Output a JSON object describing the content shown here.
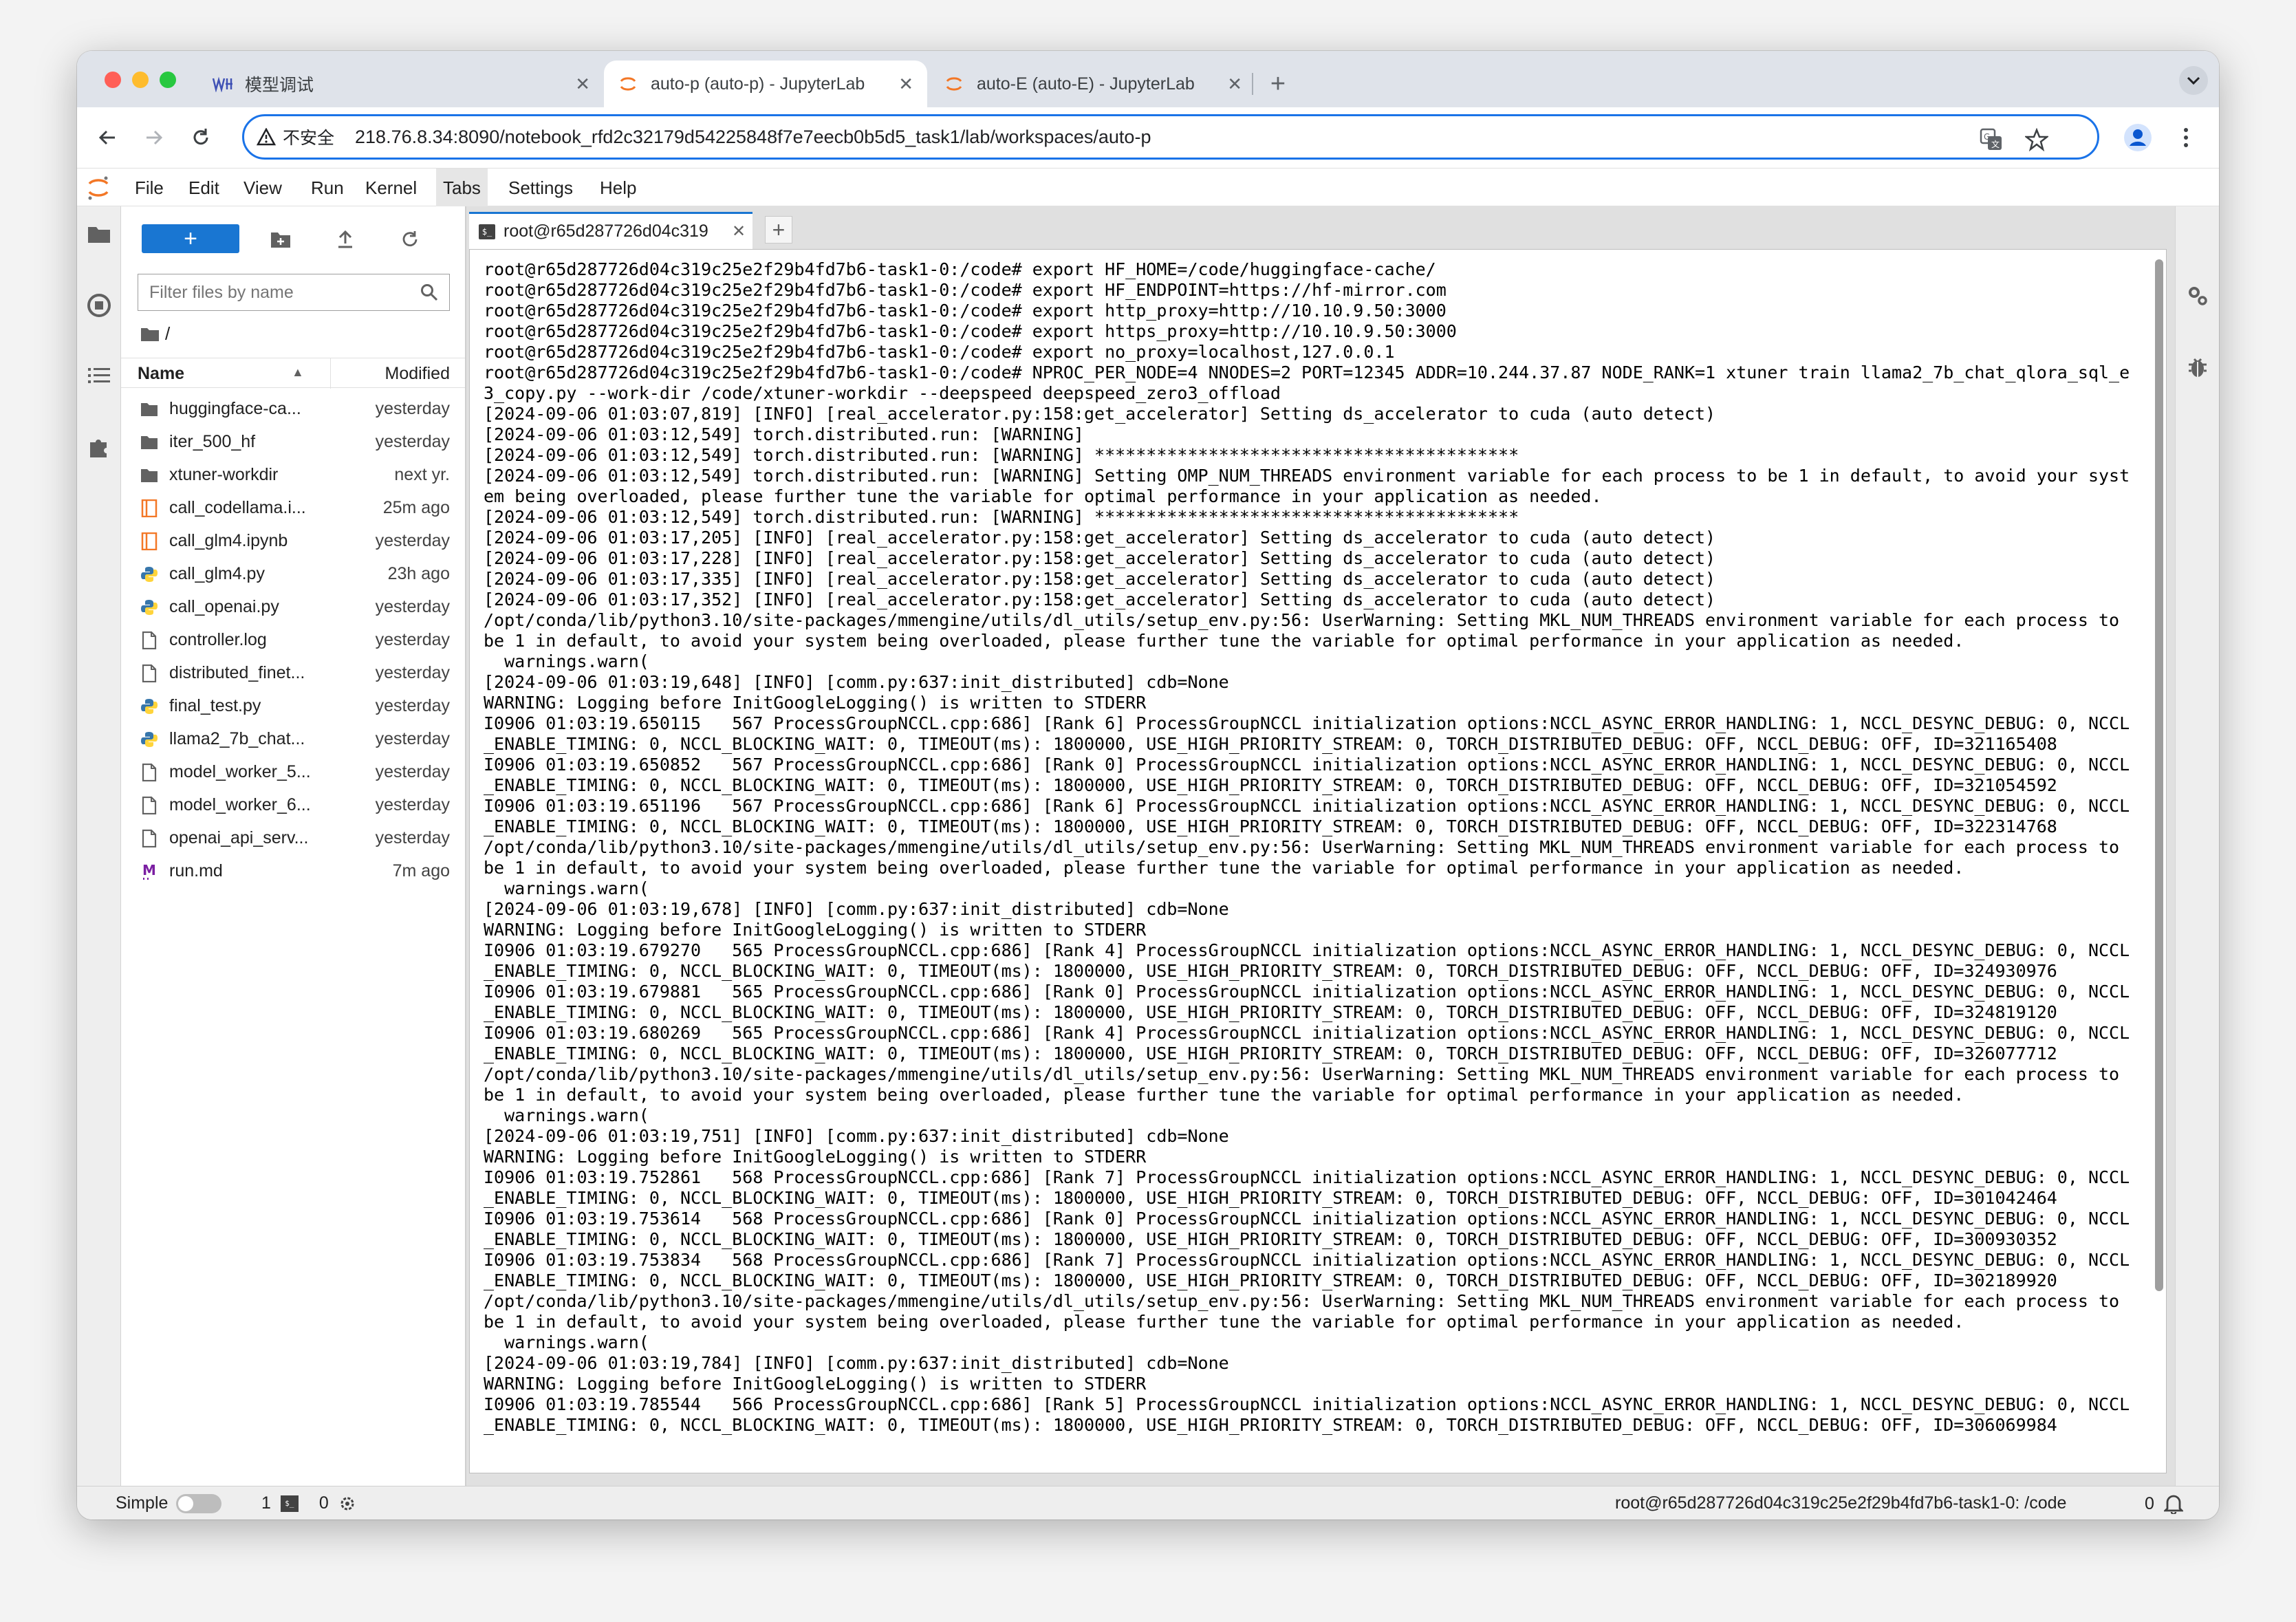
{
  "browser": {
    "tabs": [
      {
        "title": "模型调试",
        "active": false
      },
      {
        "title": "auto-p (auto-p) - JupyterLab",
        "active": true
      },
      {
        "title": "auto-E (auto-E) - JupyterLab",
        "active": false
      }
    ],
    "security_label": "不安全",
    "url": "218.76.8.34:8090/notebook_rfd2c32179d54225848f7e7eecb0b5d5_task1/lab/workspaces/auto-p"
  },
  "menubar": {
    "items": [
      "File",
      "Edit",
      "View",
      "Run",
      "Kernel",
      "Tabs",
      "Settings",
      "Help"
    ],
    "highlighted": "Tabs"
  },
  "filebrowser": {
    "new_button_label": "+",
    "filter_placeholder": "Filter files by name",
    "breadcrumb": "/",
    "columns": {
      "name": "Name",
      "modified": "Modified"
    },
    "files": [
      {
        "name": "huggingface-ca...",
        "modified": "yesterday",
        "icon": "folder-icon"
      },
      {
        "name": "iter_500_hf",
        "modified": "yesterday",
        "icon": "folder-icon"
      },
      {
        "name": "xtuner-workdir",
        "modified": "next yr.",
        "icon": "folder-icon"
      },
      {
        "name": "call_codellama.i...",
        "modified": "25m ago",
        "icon": "notebook-icon"
      },
      {
        "name": "call_glm4.ipynb",
        "modified": "yesterday",
        "icon": "notebook-icon"
      },
      {
        "name": "call_glm4.py",
        "modified": "23h ago",
        "icon": "python-icon"
      },
      {
        "name": "call_openai.py",
        "modified": "yesterday",
        "icon": "python-icon"
      },
      {
        "name": "controller.log",
        "modified": "yesterday",
        "icon": "file-icon"
      },
      {
        "name": "distributed_finet...",
        "modified": "yesterday",
        "icon": "file-icon"
      },
      {
        "name": "final_test.py",
        "modified": "yesterday",
        "icon": "python-icon"
      },
      {
        "name": "llama2_7b_chat...",
        "modified": "yesterday",
        "icon": "python-icon"
      },
      {
        "name": "model_worker_5...",
        "modified": "yesterday",
        "icon": "file-icon"
      },
      {
        "name": "model_worker_6...",
        "modified": "yesterday",
        "icon": "file-icon"
      },
      {
        "name": "openai_api_serv...",
        "modified": "yesterday",
        "icon": "file-icon"
      },
      {
        "name": "run.md",
        "modified": "7m ago",
        "icon": "markdown-icon"
      }
    ]
  },
  "terminal": {
    "tab_title": "root@r65d287726d04c319",
    "lines": [
      "root@r65d287726d04c319c25e2f29b4fd7b6-task1-0:/code# export HF_HOME=/code/huggingface-cache/",
      "root@r65d287726d04c319c25e2f29b4fd7b6-task1-0:/code# export HF_ENDPOINT=https://hf-mirror.com",
      "root@r65d287726d04c319c25e2f29b4fd7b6-task1-0:/code# export http_proxy=http://10.10.9.50:3000",
      "root@r65d287726d04c319c25e2f29b4fd7b6-task1-0:/code# export https_proxy=http://10.10.9.50:3000",
      "root@r65d287726d04c319c25e2f29b4fd7b6-task1-0:/code# export no_proxy=localhost,127.0.0.1",
      "root@r65d287726d04c319c25e2f29b4fd7b6-task1-0:/code# NPROC_PER_NODE=4 NNODES=2 PORT=12345 ADDR=10.244.37.87 NODE_RANK=1 xtuner train llama2_7b_chat_qlora_sql_e",
      "3_copy.py --work-dir /code/xtuner-workdir --deepspeed deepspeed_zero3_offload",
      "[2024-09-06 01:03:07,819] [INFO] [real_accelerator.py:158:get_accelerator] Setting ds_accelerator to cuda (auto detect)",
      "[2024-09-06 01:03:12,549] torch.distributed.run: [WARNING]",
      "[2024-09-06 01:03:12,549] torch.distributed.run: [WARNING] *****************************************",
      "[2024-09-06 01:03:12,549] torch.distributed.run: [WARNING] Setting OMP_NUM_THREADS environment variable for each process to be 1 in default, to avoid your syst",
      "em being overloaded, please further tune the variable for optimal performance in your application as needed.",
      "[2024-09-06 01:03:12,549] torch.distributed.run: [WARNING] *****************************************",
      "[2024-09-06 01:03:17,205] [INFO] [real_accelerator.py:158:get_accelerator] Setting ds_accelerator to cuda (auto detect)",
      "[2024-09-06 01:03:17,228] [INFO] [real_accelerator.py:158:get_accelerator] Setting ds_accelerator to cuda (auto detect)",
      "[2024-09-06 01:03:17,335] [INFO] [real_accelerator.py:158:get_accelerator] Setting ds_accelerator to cuda (auto detect)",
      "[2024-09-06 01:03:17,352] [INFO] [real_accelerator.py:158:get_accelerator] Setting ds_accelerator to cuda (auto detect)",
      "/opt/conda/lib/python3.10/site-packages/mmengine/utils/dl_utils/setup_env.py:56: UserWarning: Setting MKL_NUM_THREADS environment variable for each process to",
      "be 1 in default, to avoid your system being overloaded, please further tune the variable for optimal performance in your application as needed.",
      "  warnings.warn(",
      "[2024-09-06 01:03:19,648] [INFO] [comm.py:637:init_distributed] cdb=None",
      "WARNING: Logging before InitGoogleLogging() is written to STDERR",
      "I0906 01:03:19.650115   567 ProcessGroupNCCL.cpp:686] [Rank 6] ProcessGroupNCCL initialization options:NCCL_ASYNC_ERROR_HANDLING: 1, NCCL_DESYNC_DEBUG: 0, NCCL",
      "_ENABLE_TIMING: 0, NCCL_BLOCKING_WAIT: 0, TIMEOUT(ms): 1800000, USE_HIGH_PRIORITY_STREAM: 0, TORCH_DISTRIBUTED_DEBUG: OFF, NCCL_DEBUG: OFF, ID=321165408",
      "I0906 01:03:19.650852   567 ProcessGroupNCCL.cpp:686] [Rank 0] ProcessGroupNCCL initialization options:NCCL_ASYNC_ERROR_HANDLING: 1, NCCL_DESYNC_DEBUG: 0, NCCL",
      "_ENABLE_TIMING: 0, NCCL_BLOCKING_WAIT: 0, TIMEOUT(ms): 1800000, USE_HIGH_PRIORITY_STREAM: 0, TORCH_DISTRIBUTED_DEBUG: OFF, NCCL_DEBUG: OFF, ID=321054592",
      "I0906 01:03:19.651196   567 ProcessGroupNCCL.cpp:686] [Rank 6] ProcessGroupNCCL initialization options:NCCL_ASYNC_ERROR_HANDLING: 1, NCCL_DESYNC_DEBUG: 0, NCCL",
      "_ENABLE_TIMING: 0, NCCL_BLOCKING_WAIT: 0, TIMEOUT(ms): 1800000, USE_HIGH_PRIORITY_STREAM: 0, TORCH_DISTRIBUTED_DEBUG: OFF, NCCL_DEBUG: OFF, ID=322314768",
      "/opt/conda/lib/python3.10/site-packages/mmengine/utils/dl_utils/setup_env.py:56: UserWarning: Setting MKL_NUM_THREADS environment variable for each process to",
      "be 1 in default, to avoid your system being overloaded, please further tune the variable for optimal performance in your application as needed.",
      "  warnings.warn(",
      "[2024-09-06 01:03:19,678] [INFO] [comm.py:637:init_distributed] cdb=None",
      "WARNING: Logging before InitGoogleLogging() is written to STDERR",
      "I0906 01:03:19.679270   565 ProcessGroupNCCL.cpp:686] [Rank 4] ProcessGroupNCCL initialization options:NCCL_ASYNC_ERROR_HANDLING: 1, NCCL_DESYNC_DEBUG: 0, NCCL",
      "_ENABLE_TIMING: 0, NCCL_BLOCKING_WAIT: 0, TIMEOUT(ms): 1800000, USE_HIGH_PRIORITY_STREAM: 0, TORCH_DISTRIBUTED_DEBUG: OFF, NCCL_DEBUG: OFF, ID=324930976",
      "I0906 01:03:19.679881   565 ProcessGroupNCCL.cpp:686] [Rank 0] ProcessGroupNCCL initialization options:NCCL_ASYNC_ERROR_HANDLING: 1, NCCL_DESYNC_DEBUG: 0, NCCL",
      "_ENABLE_TIMING: 0, NCCL_BLOCKING_WAIT: 0, TIMEOUT(ms): 1800000, USE_HIGH_PRIORITY_STREAM: 0, TORCH_DISTRIBUTED_DEBUG: OFF, NCCL_DEBUG: OFF, ID=324819120",
      "I0906 01:03:19.680269   565 ProcessGroupNCCL.cpp:686] [Rank 4] ProcessGroupNCCL initialization options:NCCL_ASYNC_ERROR_HANDLING: 1, NCCL_DESYNC_DEBUG: 0, NCCL",
      "_ENABLE_TIMING: 0, NCCL_BLOCKING_WAIT: 0, TIMEOUT(ms): 1800000, USE_HIGH_PRIORITY_STREAM: 0, TORCH_DISTRIBUTED_DEBUG: OFF, NCCL_DEBUG: OFF, ID=326077712",
      "/opt/conda/lib/python3.10/site-packages/mmengine/utils/dl_utils/setup_env.py:56: UserWarning: Setting MKL_NUM_THREADS environment variable for each process to",
      "be 1 in default, to avoid your system being overloaded, please further tune the variable for optimal performance in your application as needed.",
      "  warnings.warn(",
      "[2024-09-06 01:03:19,751] [INFO] [comm.py:637:init_distributed] cdb=None",
      "WARNING: Logging before InitGoogleLogging() is written to STDERR",
      "I0906 01:03:19.752861   568 ProcessGroupNCCL.cpp:686] [Rank 7] ProcessGroupNCCL initialization options:NCCL_ASYNC_ERROR_HANDLING: 1, NCCL_DESYNC_DEBUG: 0, NCCL",
      "_ENABLE_TIMING: 0, NCCL_BLOCKING_WAIT: 0, TIMEOUT(ms): 1800000, USE_HIGH_PRIORITY_STREAM: 0, TORCH_DISTRIBUTED_DEBUG: OFF, NCCL_DEBUG: OFF, ID=301042464",
      "I0906 01:03:19.753614   568 ProcessGroupNCCL.cpp:686] [Rank 0] ProcessGroupNCCL initialization options:NCCL_ASYNC_ERROR_HANDLING: 1, NCCL_DESYNC_DEBUG: 0, NCCL",
      "_ENABLE_TIMING: 0, NCCL_BLOCKING_WAIT: 0, TIMEOUT(ms): 1800000, USE_HIGH_PRIORITY_STREAM: 0, TORCH_DISTRIBUTED_DEBUG: OFF, NCCL_DEBUG: OFF, ID=300930352",
      "I0906 01:03:19.753834   568 ProcessGroupNCCL.cpp:686] [Rank 7] ProcessGroupNCCL initialization options:NCCL_ASYNC_ERROR_HANDLING: 1, NCCL_DESYNC_DEBUG: 0, NCCL",
      "_ENABLE_TIMING: 0, NCCL_BLOCKING_WAIT: 0, TIMEOUT(ms): 1800000, USE_HIGH_PRIORITY_STREAM: 0, TORCH_DISTRIBUTED_DEBUG: OFF, NCCL_DEBUG: OFF, ID=302189920",
      "/opt/conda/lib/python3.10/site-packages/mmengine/utils/dl_utils/setup_env.py:56: UserWarning: Setting MKL_NUM_THREADS environment variable for each process to",
      "be 1 in default, to avoid your system being overloaded, please further tune the variable for optimal performance in your application as needed.",
      "  warnings.warn(",
      "[2024-09-06 01:03:19,784] [INFO] [comm.py:637:init_distributed] cdb=None",
      "WARNING: Logging before InitGoogleLogging() is written to STDERR",
      "I0906 01:03:19.785544   566 ProcessGroupNCCL.cpp:686] [Rank 5] ProcessGroupNCCL initialization options:NCCL_ASYNC_ERROR_HANDLING: 1, NCCL_DESYNC_DEBUG: 0, NCCL",
      "_ENABLE_TIMING: 0, NCCL_BLOCKING_WAIT: 0, TIMEOUT(ms): 1800000, USE_HIGH_PRIORITY_STREAM: 0, TORCH_DISTRIBUTED_DEBUG: OFF, NCCL_DEBUG: OFF, ID=306069984"
    ]
  },
  "statusbar": {
    "mode_label": "Simple",
    "terminals_count": "1",
    "kernels_count": "0",
    "path": "root@r65d287726d04c319c25e2f29b4fd7b6-task1-0: /code",
    "notifications_count": "0"
  },
  "colors": {
    "accent": "#1976d2",
    "omnibox_border": "#1a73e8",
    "jupyter_orange": "#f37726",
    "traffic_red": "#ff5f57",
    "traffic_yellow": "#febc2e",
    "traffic_green": "#28c840"
  }
}
